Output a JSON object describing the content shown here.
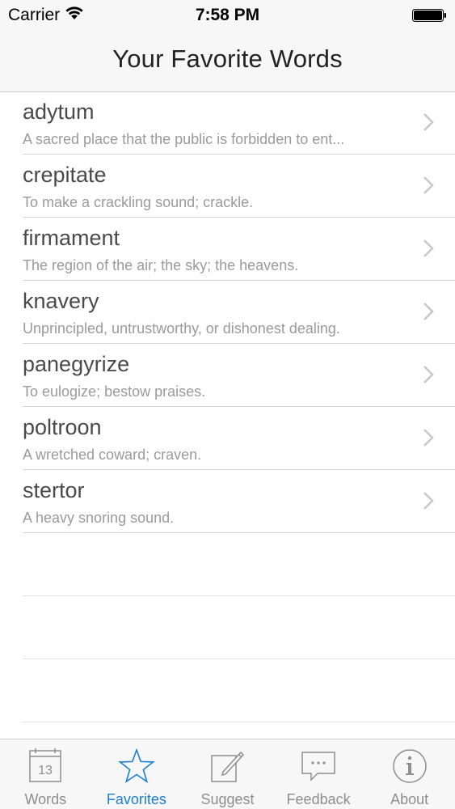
{
  "status_bar": {
    "carrier": "Carrier",
    "time": "7:58 PM"
  },
  "nav": {
    "title": "Your Favorite Words"
  },
  "favorites": [
    {
      "word": "adytum",
      "definition": "A sacred place that the public is forbidden to ent..."
    },
    {
      "word": "crepitate",
      "definition": "To make a crackling sound; crackle."
    },
    {
      "word": "firmament",
      "definition": "The region of the air; the sky; the heavens."
    },
    {
      "word": "knavery",
      "definition": "Unprincipled, untrustworthy, or dishonest dealing."
    },
    {
      "word": "panegyrize",
      "definition": "To eulogize; bestow praises."
    },
    {
      "word": "poltroon",
      "definition": "A wretched coward; craven."
    },
    {
      "word": "stertor",
      "definition": "A heavy snoring sound."
    }
  ],
  "tab_bar": {
    "calendar_day": "13",
    "tabs": [
      {
        "label": "Words",
        "icon": "calendar-icon",
        "active": false
      },
      {
        "label": "Favorites",
        "icon": "star-icon",
        "active": true
      },
      {
        "label": "Suggest",
        "icon": "compose-icon",
        "active": false
      },
      {
        "label": "Feedback",
        "icon": "chat-bubble-icon",
        "active": false
      },
      {
        "label": "About",
        "icon": "info-icon",
        "active": false
      }
    ]
  },
  "colors": {
    "accent": "#1b7fd0",
    "inactive": "#8e8e8e",
    "word_text": "#4a4a4a",
    "definition_text": "#9a9a9a"
  }
}
